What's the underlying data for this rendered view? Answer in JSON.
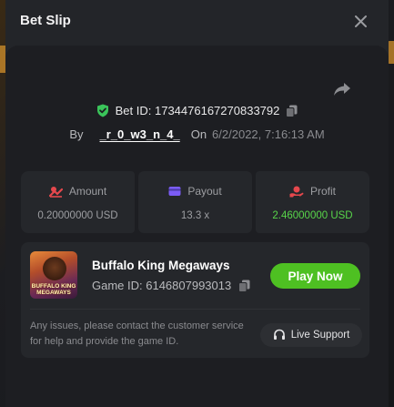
{
  "modal": {
    "title": "Bet Slip"
  },
  "bet": {
    "bet_id_text": "Bet ID: 1734476167270833792",
    "by_label": "By",
    "username": "_r_0_w3_n_4_",
    "on_label": "On",
    "date": "6/2/2022, 7:16:13 AM"
  },
  "stats": {
    "amount": {
      "label": "Amount",
      "value": "0.20000000 USD",
      "icon": "coins-icon"
    },
    "payout": {
      "label": "Payout",
      "value": "13.3 x",
      "icon": "wallet-icon"
    },
    "profit": {
      "label": "Profit",
      "value": "2.46000000 USD",
      "icon": "hand-coin-icon"
    }
  },
  "game": {
    "title": "Buffalo King Megaways",
    "game_id_text": "Game ID: 6146807993013",
    "thumbnail_caption": "BUFFALO KING MEGAWAYS",
    "play_label": "Play Now"
  },
  "support": {
    "text": "Any issues, please contact the customer service for help and provide the game ID.",
    "button_label": "Live Support"
  },
  "colors": {
    "accent_green": "#4ec022",
    "profit_green": "#58d54a",
    "icon_red": "#e5484d",
    "icon_purple": "#7b5cf5",
    "shield_green": "#3ac45a"
  }
}
